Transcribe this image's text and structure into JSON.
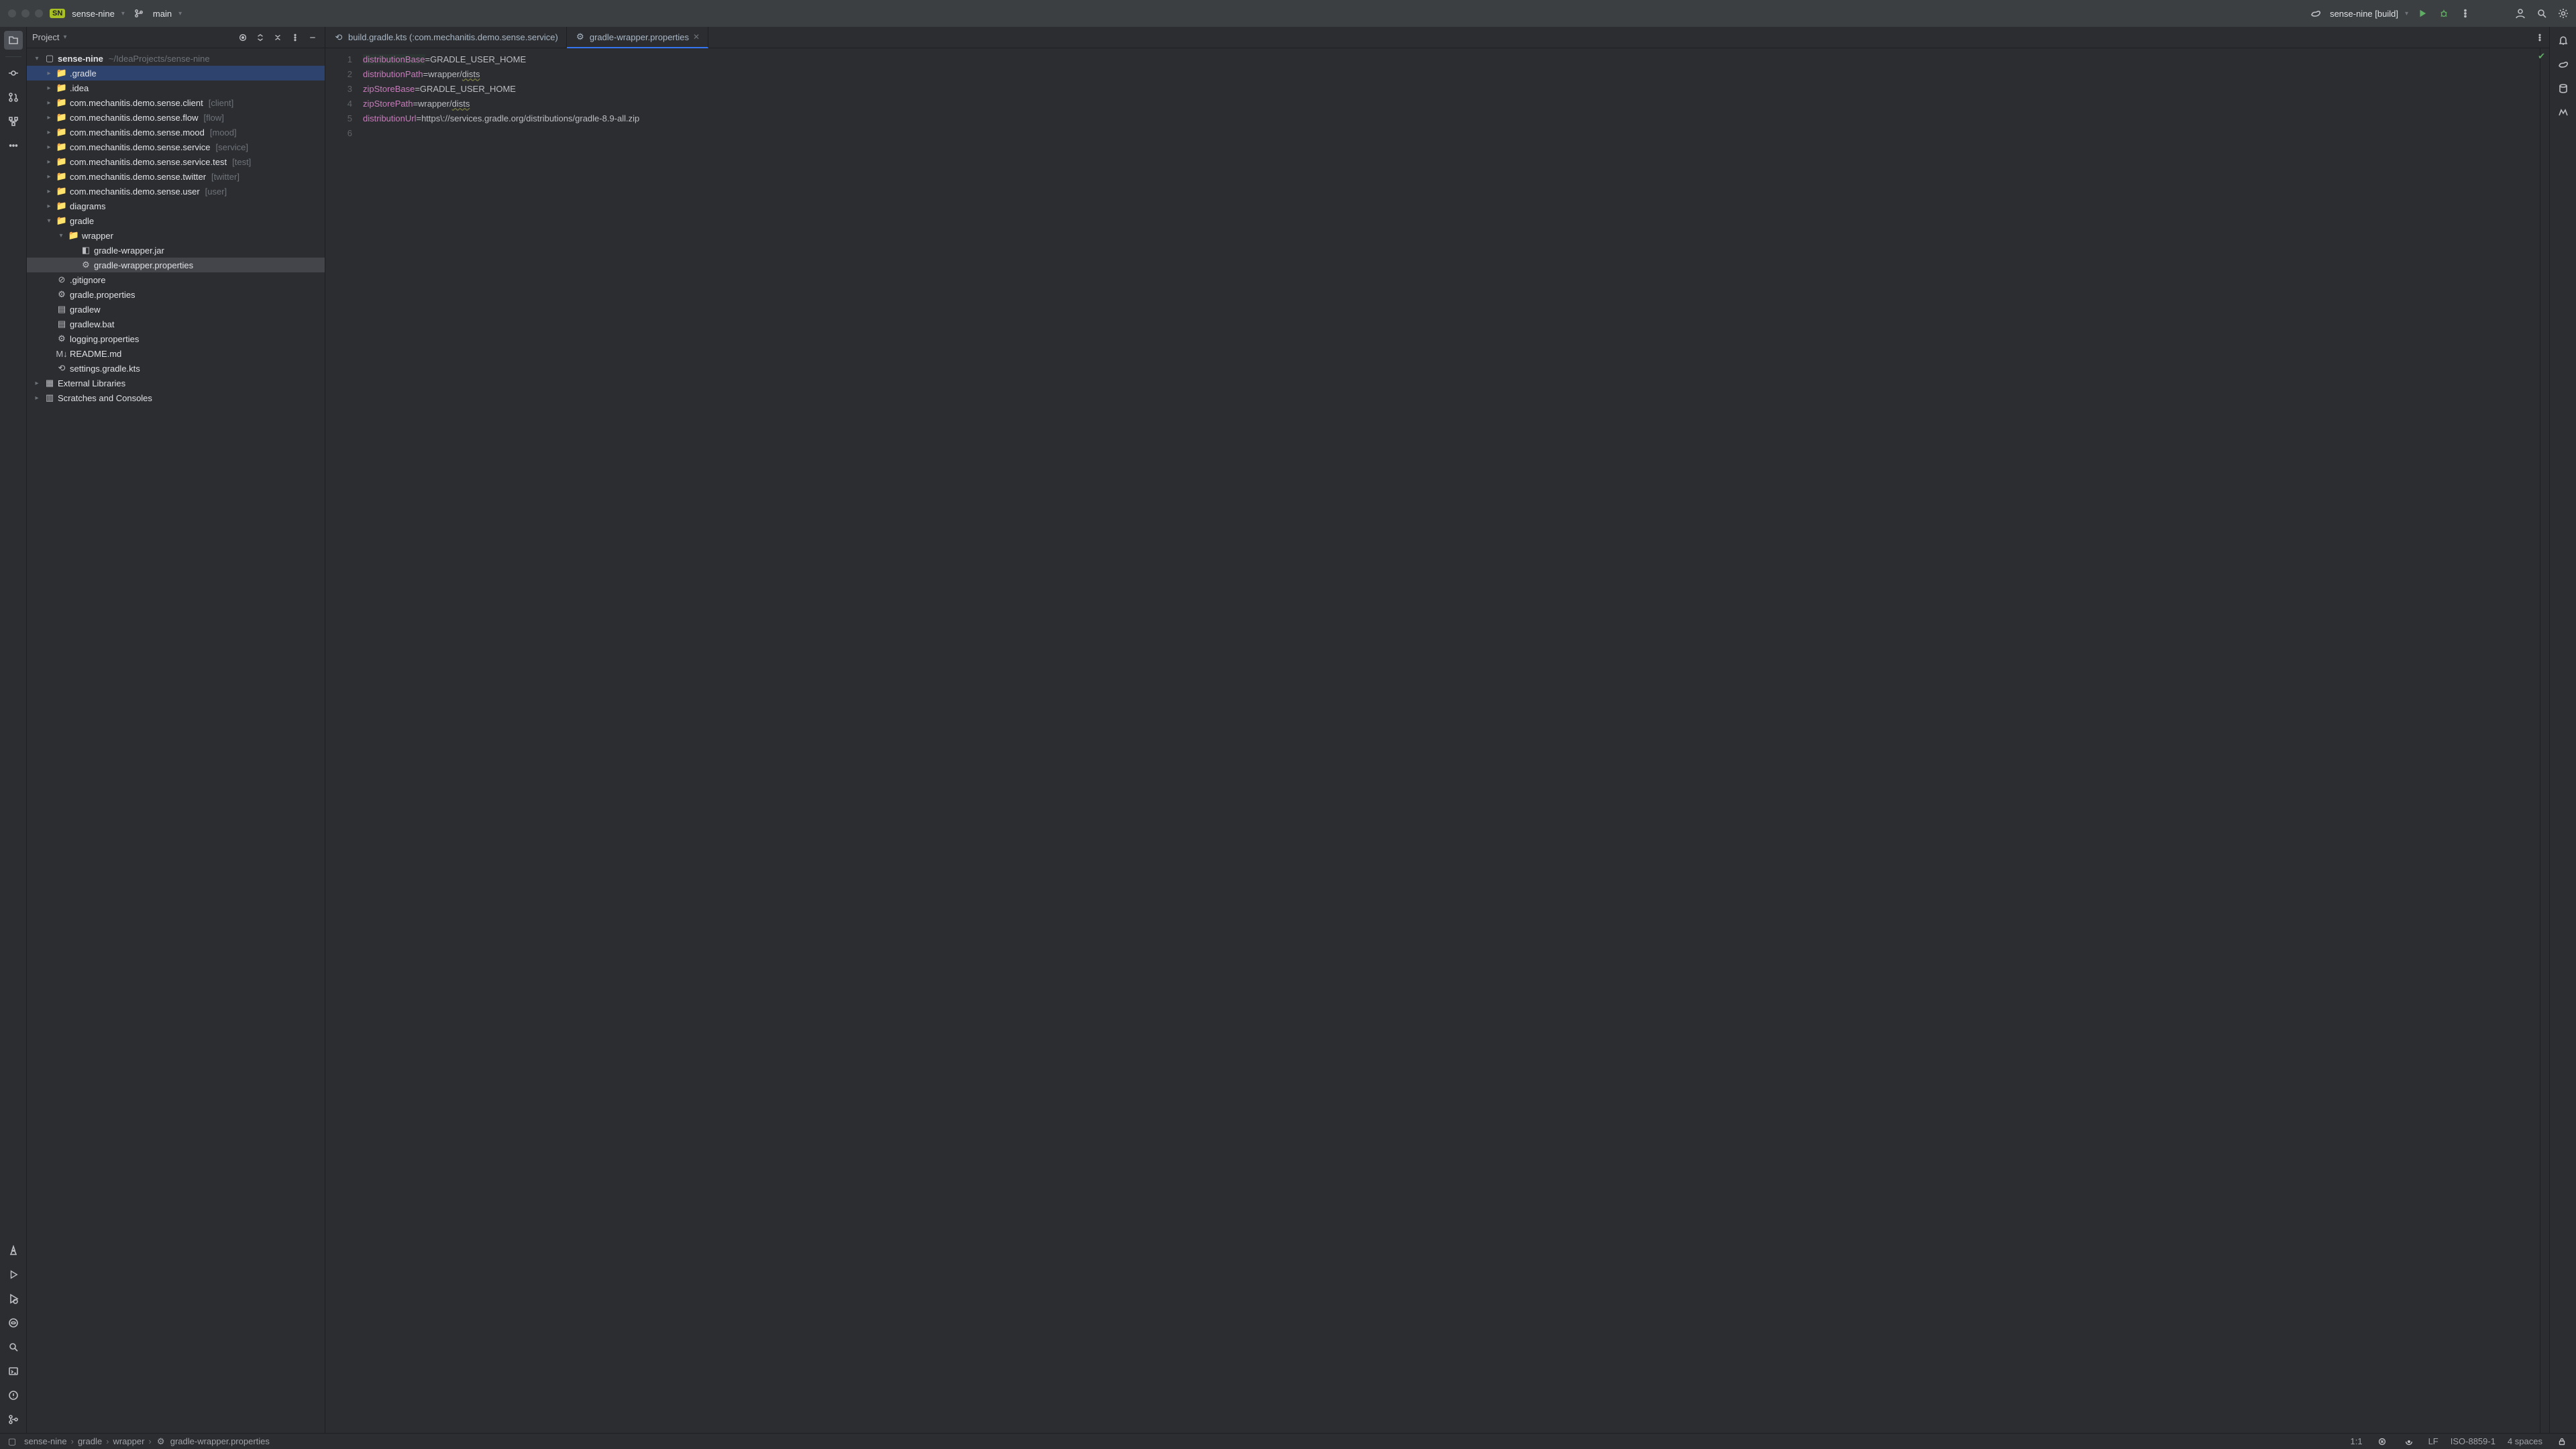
{
  "titlebar": {
    "project": "sense-nine",
    "branch": "main",
    "run_config": "sense-nine [build]"
  },
  "side": {
    "title": "Project"
  },
  "tree": {
    "root": "sense-nine",
    "root_path": "~/IdeaProjects/sense-nine",
    "gradle_folder": ".gradle",
    "idea_folder": ".idea",
    "m_client": "com.mechanitis.demo.sense.client",
    "m_client_b": "[client]",
    "m_flow": "com.mechanitis.demo.sense.flow",
    "m_flow_b": "[flow]",
    "m_mood": "com.mechanitis.demo.sense.mood",
    "m_mood_b": "[mood]",
    "m_service": "com.mechanitis.demo.sense.service",
    "m_service_b": "[service]",
    "m_service_test": "com.mechanitis.demo.sense.service.test",
    "m_service_test_b": "[test]",
    "m_twitter": "com.mechanitis.demo.sense.twitter",
    "m_twitter_b": "[twitter]",
    "m_user": "com.mechanitis.demo.sense.user",
    "m_user_b": "[user]",
    "diagrams": "diagrams",
    "gradle": "gradle",
    "wrapper": "wrapper",
    "wrapper_jar": "gradle-wrapper.jar",
    "wrapper_props": "gradle-wrapper.properties",
    "gitignore": ".gitignore",
    "gradle_props": "gradle.properties",
    "gradlew": "gradlew",
    "gradlew_bat": "gradlew.bat",
    "logging_props": "logging.properties",
    "readme": "README.md",
    "settings": "settings.gradle.kts",
    "ext_libs": "External Libraries",
    "scratches": "Scratches and Consoles"
  },
  "tabs": {
    "t1": "build.gradle.kts (:com.mechanitis.demo.sense.service)",
    "t2": "gradle-wrapper.properties"
  },
  "gutter": {
    "l1": "1",
    "l2": "2",
    "l3": "3",
    "l4": "4",
    "l5": "5",
    "l6": "6"
  },
  "code": {
    "k1": "distributionBase",
    "v1": "GRADLE_USER_HOME",
    "k2": "distributionPath",
    "v2a": "wrapper/",
    "v2b": "dists",
    "k3": "zipStoreBase",
    "v3": "GRADLE_USER_HOME",
    "k4": "zipStorePath",
    "v4a": "wrapper/",
    "v4b": "dists",
    "k5": "distributionUrl",
    "v5a": "https",
    "v5b": "\\://services.gradle.org/distributions/gradle-8.9-all.zip"
  },
  "crumbs": {
    "c1": "sense-nine",
    "c2": "gradle",
    "c3": "wrapper",
    "c4": "gradle-wrapper.properties"
  },
  "status": {
    "pos": "1:1",
    "line_end": "LF",
    "enc": "ISO-8859-1",
    "indent": "4 spaces"
  }
}
